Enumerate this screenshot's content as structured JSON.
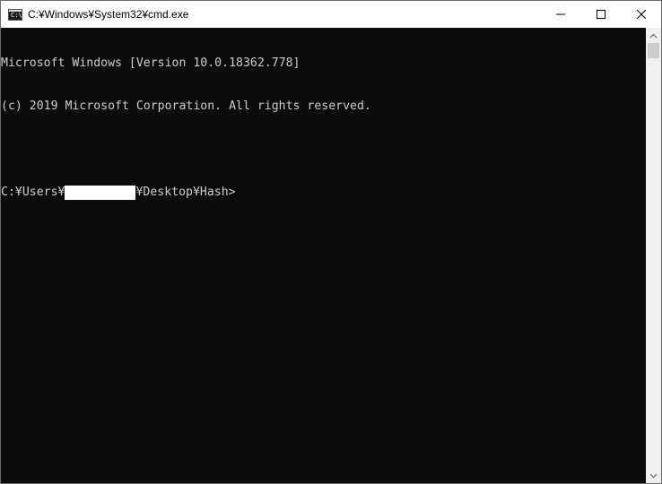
{
  "window": {
    "title": "C:¥Windows¥System32¥cmd.exe",
    "icon": "cmd-icon",
    "icon_glyph": "C:\\"
  },
  "controls": {
    "minimize_icon": "minimize-icon",
    "maximize_icon": "maximize-icon",
    "close_icon": "close-icon"
  },
  "console": {
    "line1": "Microsoft Windows [Version 10.0.18362.778]",
    "line2": "(c) 2019 Microsoft Corporation. All rights reserved.",
    "prompt_prefix": "C:¥Users¥",
    "prompt_suffix": "¥Desktop¥Hash>"
  },
  "colors": {
    "console_bg": "#0c0c0c",
    "console_fg": "#cccccc",
    "titlebar_bg": "#ffffff"
  }
}
